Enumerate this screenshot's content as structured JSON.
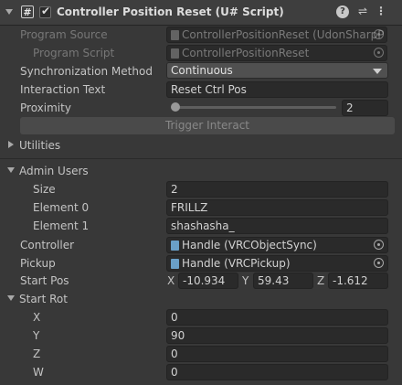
{
  "header": {
    "script_icon": "#",
    "title": "Controller Position Reset (U# Script)",
    "icons": [
      "help-icon",
      "presets-icon",
      "kebab-menu-icon"
    ]
  },
  "program_source": {
    "label": "Program Source",
    "value": "ControllerPositionReset (UdonSharpP"
  },
  "program_script": {
    "label": "Program Script",
    "value": "ControllerPositionReset"
  },
  "sync_method": {
    "label": "Synchronization Method",
    "value": "Continuous"
  },
  "interaction_text": {
    "label": "Interaction Text",
    "value": "Reset Ctrl Pos"
  },
  "proximity": {
    "label": "Proximity",
    "value": "2",
    "slider_fraction": 0.02
  },
  "trigger_interact": {
    "label": "Trigger Interact"
  },
  "utilities": {
    "label": "Utilities"
  },
  "admin_users": {
    "label": "Admin Users",
    "size_label": "Size",
    "size_value": "2",
    "elements": [
      {
        "label": "Element 0",
        "value": "FRILLZ"
      },
      {
        "label": "Element 1",
        "value": "shashasha_"
      }
    ]
  },
  "controller": {
    "label": "Controller",
    "value": "Handle (VRCObjectSync)"
  },
  "pickup": {
    "label": "Pickup",
    "value": "Handle (VRCPickup)"
  },
  "start_pos": {
    "label": "Start Pos",
    "x_label": "X",
    "x": "-10.934",
    "y_label": "Y",
    "y": "59.43",
    "z_label": "Z",
    "z": "-1.612"
  },
  "start_rot": {
    "label": "Start Rot",
    "x_label": "X",
    "x": "0",
    "y_label": "Y",
    "y": "90",
    "z_label": "Z",
    "z": "0",
    "w_label": "W",
    "w": "0"
  }
}
